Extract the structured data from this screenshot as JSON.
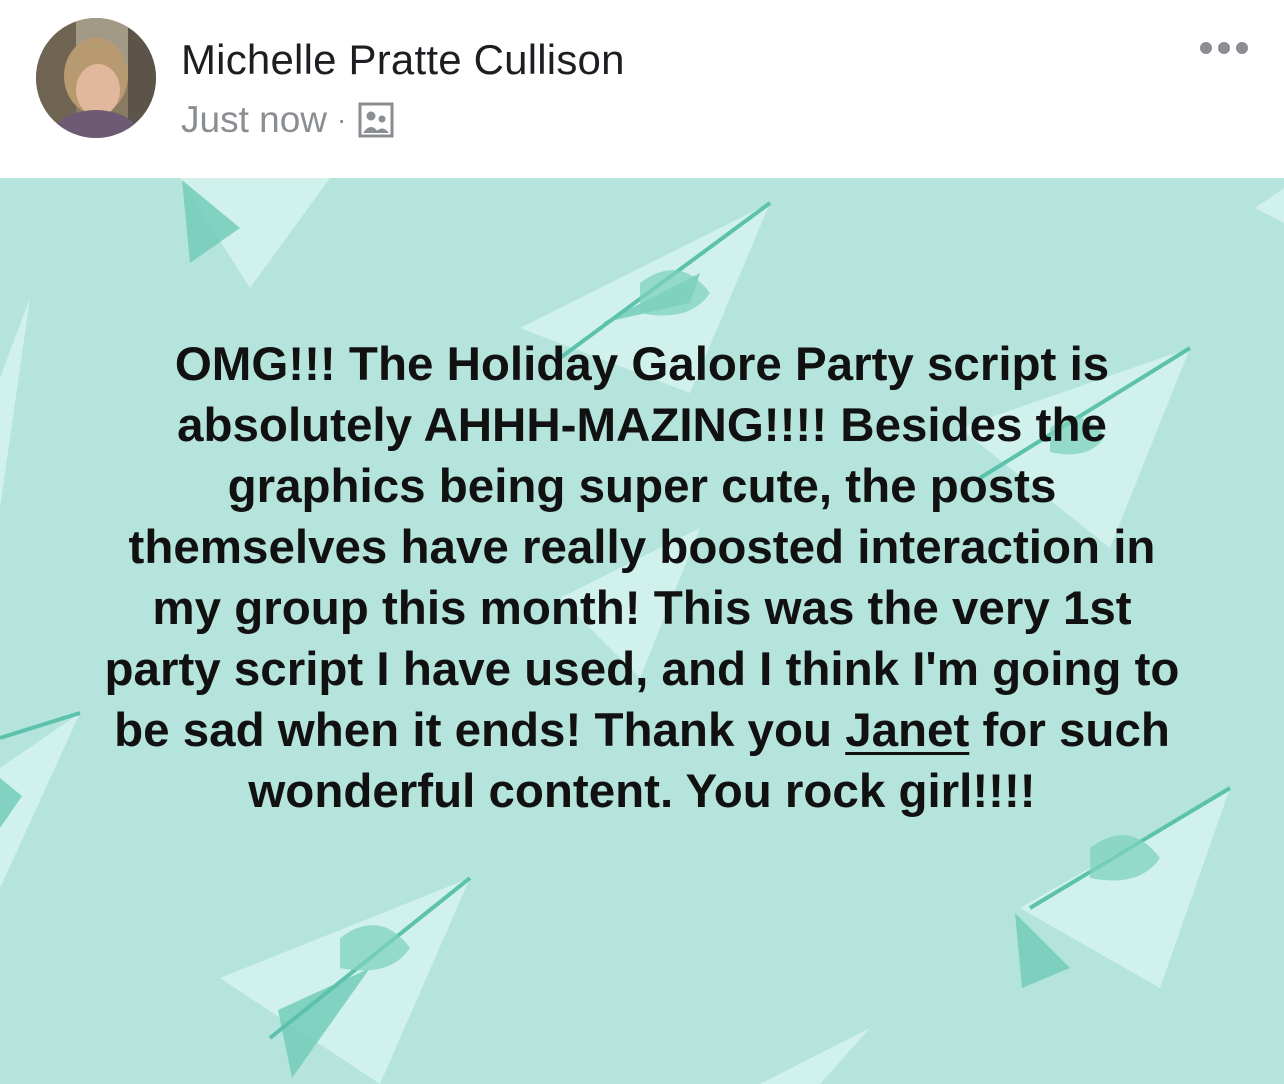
{
  "post": {
    "author": "Michelle Pratte Cullison",
    "timestamp": "Just now",
    "separator": "·",
    "audience_icon": "group-icon",
    "more_icon": "more-dots-icon",
    "text_before": "OMG!!! The Holiday Galore Party script is absolutely AHHH-MAZING!!!! Besides the graphics being super cute, the posts themselves have really boosted interaction in my group this month! This was the very 1st party script I have used, and I think I'm going to be sad when it ends! Thank you ",
    "mention": "Janet",
    "text_after": " for such wonderful content. You rock girl!!!!"
  },
  "colors": {
    "background": "#b5e4dc",
    "plane_light": "#d3f2ec",
    "plane_dark": "#73cdb9",
    "text": "#111111",
    "meta": "#8a8d91"
  }
}
